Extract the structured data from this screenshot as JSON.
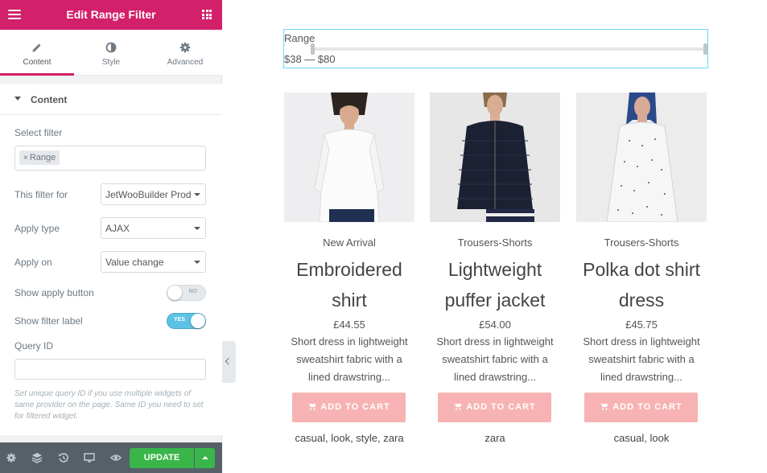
{
  "panel": {
    "title": "Edit Range Filter",
    "tabs": [
      {
        "label": "Content",
        "icon": "pencil-icon",
        "active": true
      },
      {
        "label": "Style",
        "icon": "half-circle-icon",
        "active": false
      },
      {
        "label": "Advanced",
        "icon": "gear-icon",
        "active": false
      }
    ],
    "section_title": "Content",
    "select_filter_label": "Select filter",
    "select_filter_tag": "Range",
    "filter_for_label": "This filter for",
    "filter_for_value": "JetWooBuilder Products Grid",
    "apply_type_label": "Apply type",
    "apply_type_value": "AJAX",
    "apply_on_label": "Apply on",
    "apply_on_value": "Value change",
    "show_apply_button_label": "Show apply button",
    "show_apply_button_state": "NO",
    "show_filter_label_label": "Show filter label",
    "show_filter_label_state": "YES",
    "query_id_label": "Query ID",
    "query_id_value": "",
    "query_id_note": "Set unique query ID if you use multiple widgets of same provider on the page. Same ID you need to set for filtered widget.",
    "update_label": "UPDATE"
  },
  "colors": {
    "brand": "#d3206a",
    "update": "#39b54a",
    "toggle_on": "#5cc2e6",
    "cart_button": "#f7b3b3",
    "focus_border": "#71d7f7"
  },
  "range_filter": {
    "label": "Range",
    "value": "$38 — $80"
  },
  "products": [
    {
      "category": "New Arrival",
      "name": "Embroidered shirt",
      "price": "£44.55",
      "description": "Short dress in lightweight sweatshirt fabric with a lined drawstring...",
      "cart_label": "ADD TO CART",
      "tags": "casual, look, style, zara"
    },
    {
      "category": "Trousers-Shorts",
      "name": "Lightweight puffer jacket",
      "price": "£54.00",
      "description": "Short dress in lightweight sweatshirt fabric with a lined drawstring...",
      "cart_label": "ADD TO CART",
      "tags": "zara"
    },
    {
      "category": "Trousers-Shorts",
      "name": "Polka dot shirt dress",
      "price": "£45.75",
      "description": "Short dress in lightweight sweatshirt fabric with a lined drawstring...",
      "cart_label": "ADD TO CART",
      "tags": "casual, look"
    }
  ]
}
